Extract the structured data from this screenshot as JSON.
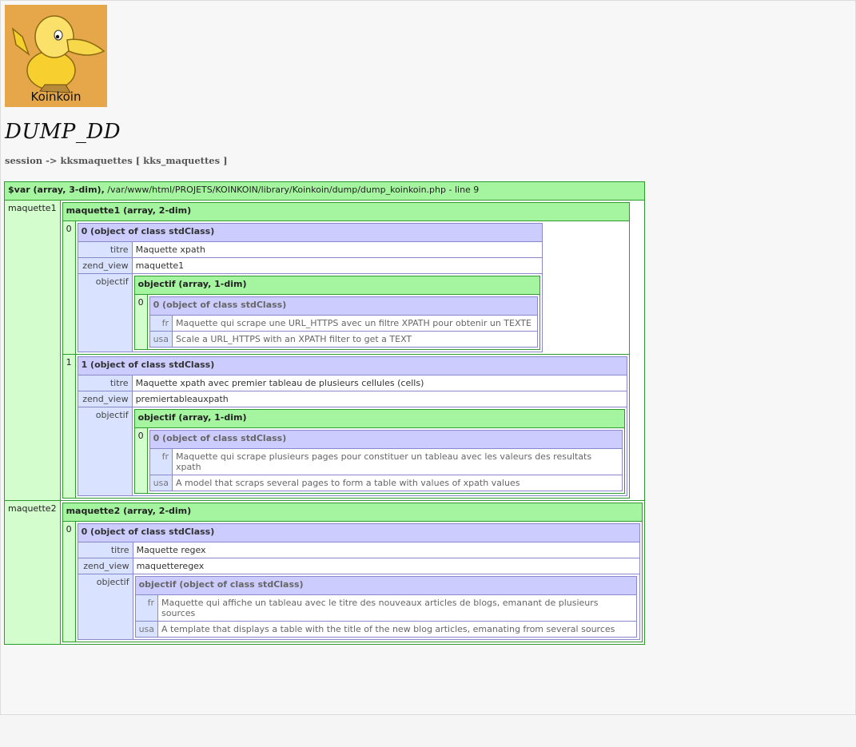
{
  "logo": {
    "text": "Koinkoin"
  },
  "page_title": "DUMP_DD",
  "subtitle": "session -> kksmaquettes [ kks_maquettes ]",
  "dump": {
    "head_bold": "$var (array, 3-dim),",
    "head_path": " /var/www/html/PROJETS/KOINKOIN/library/Koinkoin/dump/dump_koinkoin.php - line 9",
    "maquette1": {
      "key": "maquette1",
      "head": "maquette1 (array, 2-dim)",
      "items": [
        {
          "index": "0",
          "head": "0 (object of class stdClass)",
          "titre_key": "titre",
          "titre": "Maquette xpath",
          "zend_key": "zend_view",
          "zend_view": "maquette1",
          "obj_key": "objectif",
          "obj_head": "objectif (array, 1-dim)",
          "inner_index": "0",
          "inner_head": "0 (object of class stdClass)",
          "fr_key": "fr",
          "fr": "Maquette qui scrape une URL_HTTPS avec un filtre XPATH pour obtenir un TEXTE",
          "usa_key": "usa",
          "usa": "Scale a URL_HTTPS with an XPATH filter to get a TEXT"
        },
        {
          "index": "1",
          "head": "1 (object of class stdClass)",
          "titre_key": "titre",
          "titre": "Maquette xpath avec premier tableau de plusieurs cellules (cells)",
          "zend_key": "zend_view",
          "zend_view": "premiertableauxpath",
          "obj_key": "objectif",
          "obj_head": "objectif (array, 1-dim)",
          "inner_index": "0",
          "inner_head": "0 (object of class stdClass)",
          "fr_key": "fr",
          "fr": "Maquette qui scrape plusieurs pages pour constituer un tableau avec les valeurs des resultats xpath",
          "usa_key": "usa",
          "usa": "A model that scraps several pages to form a table with values of xpath values"
        }
      ]
    },
    "maquette2": {
      "key": "maquette2",
      "head": "maquette2 (array, 2-dim)",
      "item": {
        "index": "0",
        "head": "0 (object of class stdClass)",
        "titre_key": "titre",
        "titre": "Maquette regex",
        "zend_key": "zend_view",
        "zend_view": "maquetteregex",
        "obj_key": "objectif",
        "obj_head": "objectif (object of class stdClass)",
        "fr_key": "fr",
        "fr": "Maquette qui affiche un tableau avec le titre des nouveaux articles de blogs, emanant de plusieurs sources",
        "usa_key": "usa",
        "usa": "A template that displays a table with the title of the new blog articles, emanating from several sources"
      }
    }
  }
}
